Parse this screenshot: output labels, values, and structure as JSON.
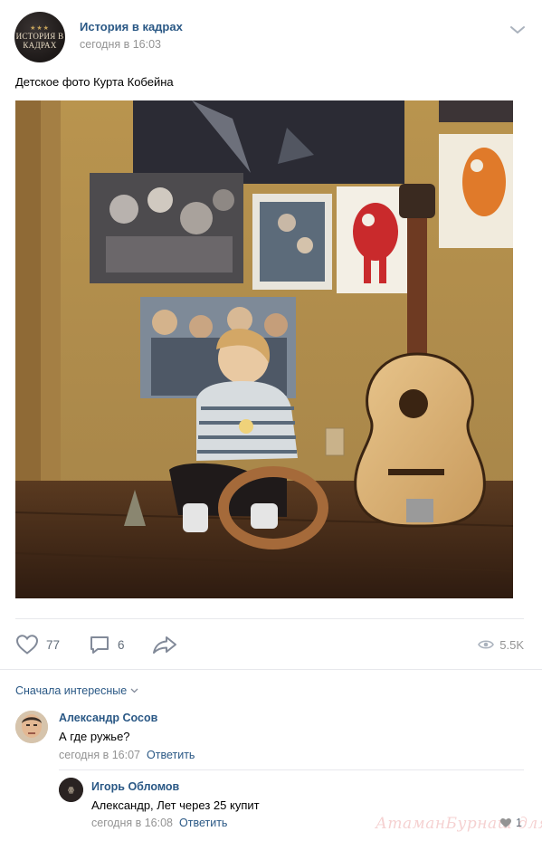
{
  "post": {
    "group_name": "История в кадрах",
    "group_logo_text": "ИСТОРИЯ В КАДРАХ",
    "time": "сегодня в 16:03",
    "text": "Детское фото Курта Кобейна",
    "photo_icon": "photo-of-child-with-guitar"
  },
  "actions": {
    "likes": "77",
    "comments": "6",
    "views": "5.5K"
  },
  "comments_sort": "Сначала интересные",
  "comments": [
    {
      "author": "Александр Сосов",
      "text": "А где ружье?",
      "time": "сегодня в 16:07",
      "reply_label": "Ответить"
    },
    {
      "author": "Игорь Обломов",
      "text": "Александр, Лет через 25 купит",
      "time": "сегодня в 16:08",
      "reply_label": "Ответить",
      "likes": "1"
    }
  ],
  "watermark": "АтаманБурнаш для ЯП",
  "colors": {
    "link": "#2a5885",
    "secondary": "#939393",
    "divider": "#e7e8ec",
    "icon": "#828282"
  }
}
